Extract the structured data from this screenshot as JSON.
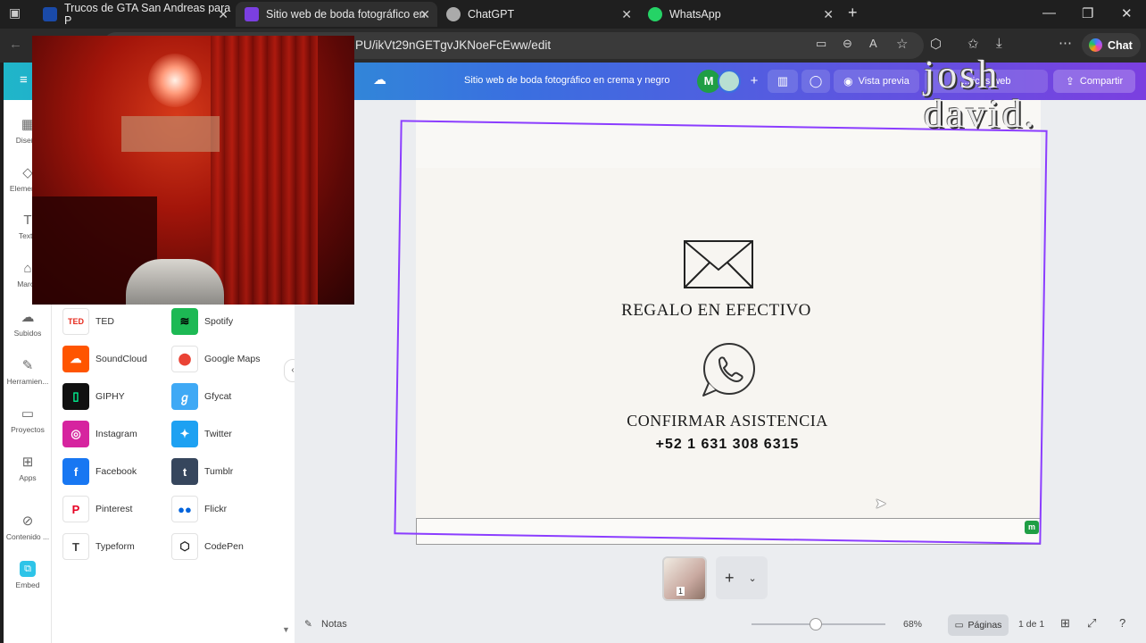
{
  "browser": {
    "tabs": [
      {
        "label": "Trucos de GTA San Andreas para P",
        "favicon_color": "#1a4aa8"
      },
      {
        "label": "Sitio web de boda fotográfico en",
        "favicon_color": "#7b3fe0"
      },
      {
        "label": "ChatGPT",
        "favicon_color": "#aaaaaa"
      },
      {
        "label": "WhatsApp",
        "favicon_color": "#25d366"
      }
    ],
    "url_visible": "PU/ikVt29nGETgvJKNoeFcEww/edit",
    "chat_label": "Chat"
  },
  "canva": {
    "doc_title": "Sitio web de boda fotográfico en crema y negro",
    "avatar_initial": "M",
    "preview_label": "Vista previa",
    "analytics_label": "...ticas web",
    "share_label": "Compartir"
  },
  "rail": [
    {
      "label": "Diseño",
      "icon": "layout-icon"
    },
    {
      "label": "Elementos",
      "icon": "elements-icon"
    },
    {
      "label": "Texto",
      "icon": "text-icon"
    },
    {
      "label": "Marca",
      "icon": "brand-icon"
    },
    {
      "label": "Subidos",
      "icon": "upload-icon"
    },
    {
      "label": "Herramien...",
      "icon": "tools-icon"
    },
    {
      "label": "Proyectos",
      "icon": "folder-icon"
    },
    {
      "label": "Apps",
      "icon": "apps-icon"
    },
    {
      "label": "Contenido ...",
      "icon": "content-icon"
    },
    {
      "label": "Embed",
      "icon": "embed-icon"
    }
  ],
  "apps": [
    {
      "label": "TED",
      "color": "#ffffff",
      "text": "#e62b1e",
      "glyph": "TED"
    },
    {
      "label": "Spotify",
      "color": "#1db954",
      "text": "#000000",
      "glyph": "≋"
    },
    {
      "label": "SoundCloud",
      "color": "#ff5500",
      "text": "#ffffff",
      "glyph": "☁"
    },
    {
      "label": "Google Maps",
      "color": "#ffffff",
      "text": "#ea4335",
      "glyph": "⬤"
    },
    {
      "label": "GIPHY",
      "color": "#111111",
      "text": "#00ff99",
      "glyph": "▯"
    },
    {
      "label": "Gfycat",
      "color": "#3fa9f5",
      "text": "#ffffff",
      "glyph": "ℊ"
    },
    {
      "label": "Instagram",
      "color": "#d6249f",
      "text": "#ffffff",
      "glyph": "◎"
    },
    {
      "label": "Twitter",
      "color": "#1da1f2",
      "text": "#ffffff",
      "glyph": "✦"
    },
    {
      "label": "Facebook",
      "color": "#1877f2",
      "text": "#ffffff",
      "glyph": "f"
    },
    {
      "label": "Tumblr",
      "color": "#36465d",
      "text": "#ffffff",
      "glyph": "t"
    },
    {
      "label": "Pinterest",
      "color": "#ffffff",
      "text": "#e60023",
      "glyph": "P"
    },
    {
      "label": "Flickr",
      "color": "#ffffff",
      "text": "#0063dc",
      "glyph": "●●"
    },
    {
      "label": "Typeform",
      "color": "#ffffff",
      "text": "#444444",
      "glyph": "T"
    },
    {
      "label": "CodePen",
      "color": "#ffffff",
      "text": "#222222",
      "glyph": "⬡"
    }
  ],
  "canvas": {
    "gift_label": "REGALO EN EFECTIVO",
    "rsvp_label": "CONFIRMAR ASISTENCIA",
    "phone": "+52 1 631 308 6315",
    "badge": "m"
  },
  "watermark": {
    "line1": "josh",
    "line2": "david."
  },
  "bottom": {
    "notes_label": "Notas",
    "zoom": "68%",
    "pages_label": "Páginas",
    "page_count": "1 de 1",
    "thumb_page": "1"
  }
}
